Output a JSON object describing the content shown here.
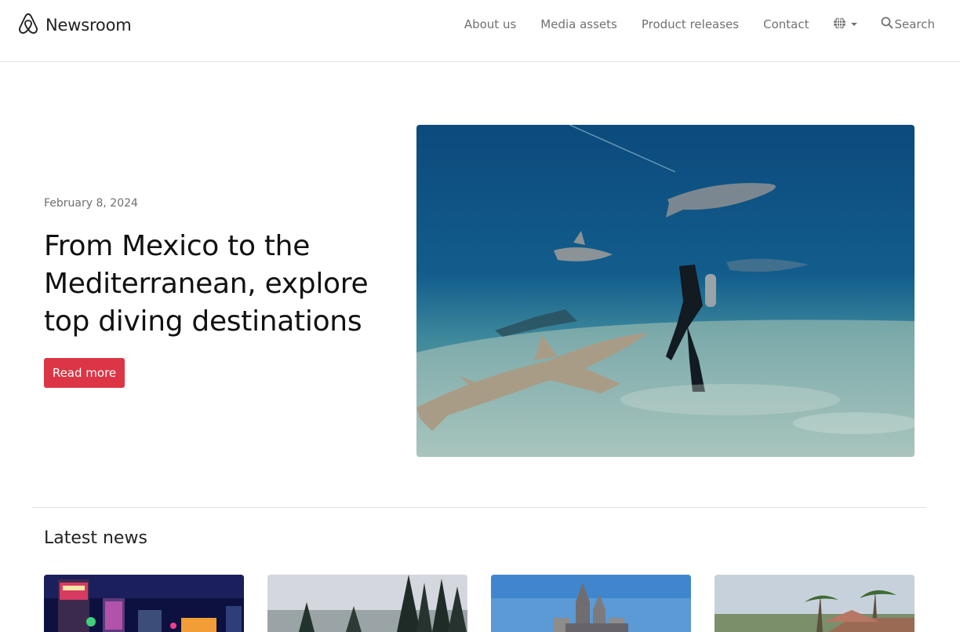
{
  "header": {
    "brand_name": "Newsroom",
    "brand_icon": "airbnb-logo-icon",
    "nav": {
      "about": "About us",
      "media": "Media assets",
      "releases": "Product releases",
      "contact": "Contact"
    },
    "language_icon": "globe-icon",
    "search_label": "Search",
    "search_icon": "search-icon"
  },
  "hero": {
    "date": "February 8, 2024",
    "title": "From Mexico to the Mediterranean, explore top diving destinations",
    "button_label": "Read more",
    "image_subject": "divers-with-sharks-underwater"
  },
  "latest": {
    "heading": "Latest news",
    "cards": [
      {
        "image_subject": "new-york-new-york-casino-night"
      },
      {
        "image_subject": "snowy-pine-forest"
      },
      {
        "image_subject": "hogwarts-castle"
      },
      {
        "image_subject": "tropical-palm-trees-house"
      }
    ]
  },
  "colors": {
    "accent": "#dc3545",
    "nav_text": "#717171",
    "divider": "#e2e2e2"
  }
}
